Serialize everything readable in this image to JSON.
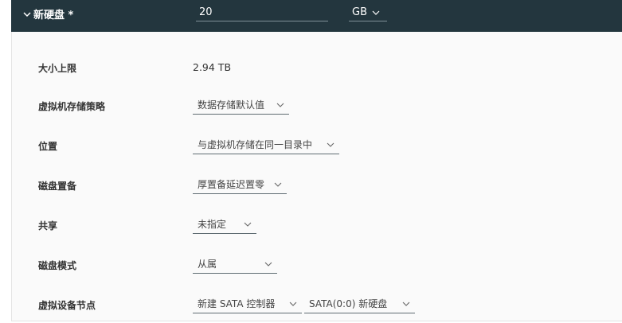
{
  "header": {
    "title": "新硬盘 *",
    "size_value": "20",
    "unit": "GB",
    "bg_color": "#23363e"
  },
  "fields": {
    "max_size": {
      "label": "大小上限",
      "value": "2.94 TB"
    },
    "vm_storage_policy": {
      "label": "虚拟机存储策略",
      "value": "数据存储默认值"
    },
    "location": {
      "label": "位置",
      "value": "与虚拟机存储在同一目录中"
    },
    "disk_provisioning": {
      "label": "磁盘置备",
      "value": "厚置备延迟置零"
    },
    "sharing": {
      "label": "共享",
      "value": "未指定"
    },
    "disk_mode": {
      "label": "磁盘模式",
      "value": "从属"
    },
    "virtual_device_node": {
      "label": "虚拟设备节点",
      "controller": "新建 SATA 控制器",
      "node": "SATA(0:0) 新硬盘"
    }
  },
  "icons": [
    "chevron-down-icon"
  ]
}
